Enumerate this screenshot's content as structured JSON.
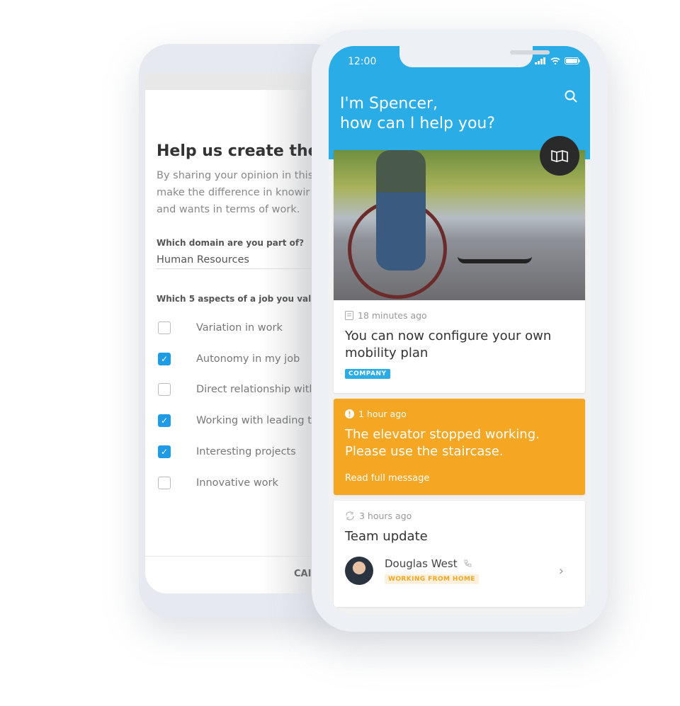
{
  "survey": {
    "title": "Help us create the",
    "description": [
      "By sharing your opinion in this",
      "make the difference in knowir",
      "and wants in terms of work."
    ],
    "domain_label": "Which domain are you part of?",
    "domain_value": "Human Resources",
    "aspects_label": "Which 5 aspects of a job you value",
    "options": [
      {
        "label": "Variation in work",
        "checked": false
      },
      {
        "label": "Autonomy in my job",
        "checked": true
      },
      {
        "label": "Direct relationship witl",
        "checked": false
      },
      {
        "label": "Working with leading t",
        "checked": true
      },
      {
        "label": "Interesting projects",
        "checked": true
      },
      {
        "label": "Innovative work",
        "checked": false
      }
    ],
    "cancel_label": "CAI"
  },
  "app": {
    "time": "12:00",
    "greeting_line1": "I'm Spencer,",
    "greeting_line2": "how can I help you?",
    "accent": "#2aace6",
    "alert_color": "#f5a623",
    "cards": [
      {
        "icon": "document-icon",
        "time": "18 minutes ago",
        "title": "You can now configure your own mobility plan",
        "tag": "COMPANY"
      },
      {
        "icon": "alert-icon",
        "time": "1 hour ago",
        "title_line1": "The elevator stopped working.",
        "title_line2": "Please use the staircase.",
        "link": "Read full message"
      },
      {
        "icon": "sync-icon",
        "time": "3 hours ago",
        "title": "Team update",
        "person": {
          "name": "Douglas West",
          "status": "WORKING FROM HOME"
        }
      }
    ]
  }
}
